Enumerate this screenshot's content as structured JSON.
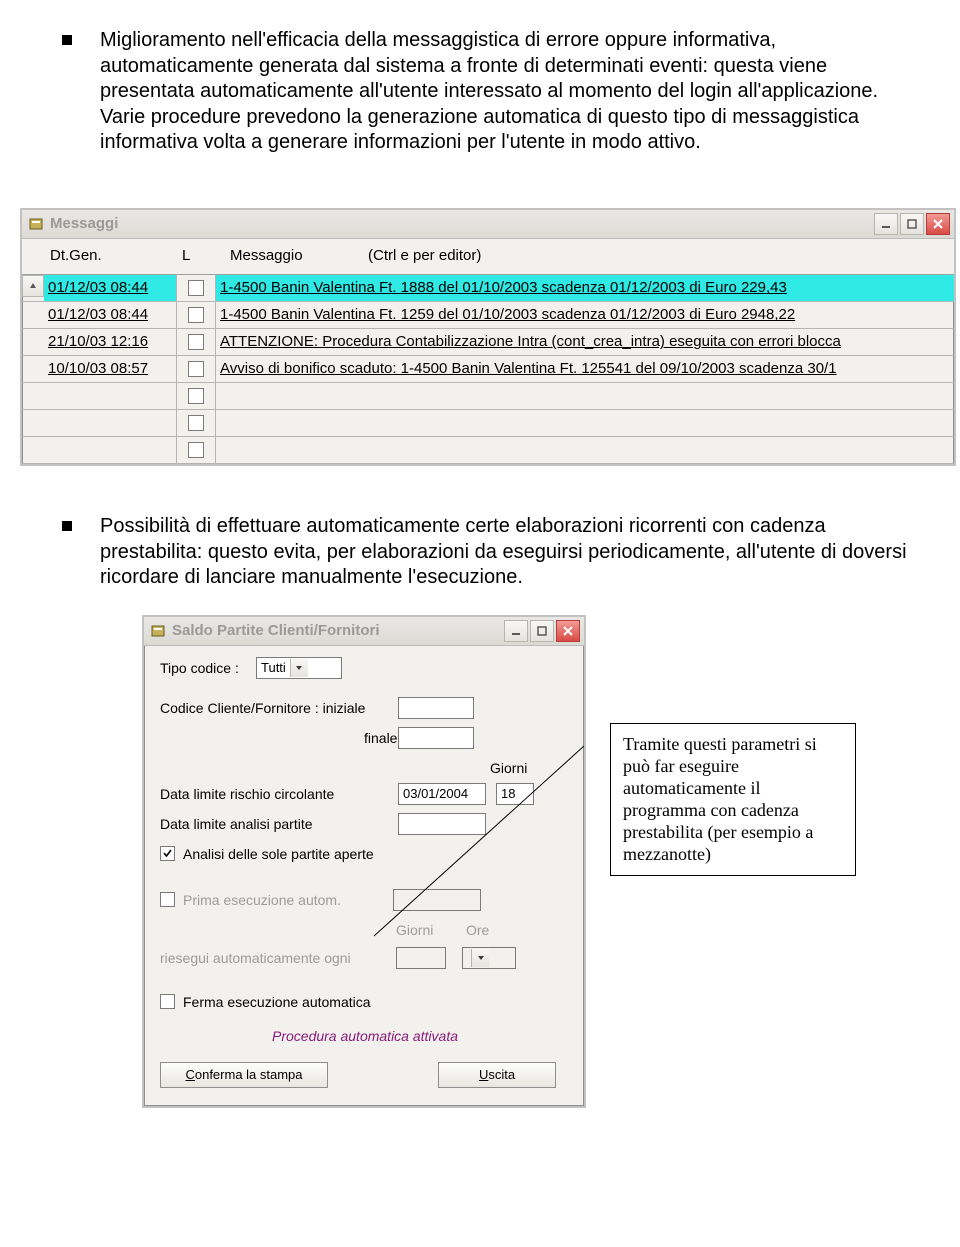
{
  "paragraphs": {
    "p1": "Miglioramento nell'efficacia della messaggistica di errore oppure informativa, automaticamente generata dal sistema a fronte di determinati eventi: questa viene presentata automaticamente all'utente interessato al momento del login all'applicazione. Varie procedure prevedono la generazione automatica di questo tipo di messaggistica informativa volta a generare informazioni per l'utente in modo attivo.",
    "p2": "Possibilità di effettuare automaticamente certe elaborazioni ricorrenti con cadenza prestabilita: questo evita, per elaborazioni da eseguirsi periodicamente, all'utente di doversi ricordare di lanciare manualmente l'esecuzione."
  },
  "messages_window": {
    "title": "Messaggi",
    "headers": {
      "dt": "Dt.Gen.",
      "l": "L",
      "msg": "Messaggio",
      "editor": "(Ctrl e per editor)"
    },
    "rows": [
      {
        "dt": "01/12/03 08:44",
        "msg": "1-4500 Banin Valentina Ft. 1888 del 01/10/2003 scadenza 01/12/2003 di Euro 229,43",
        "selected": true
      },
      {
        "dt": "01/12/03 08:44",
        "msg": "1-4500 Banin Valentina Ft. 1259 del 01/10/2003 scadenza 01/12/2003 di Euro 2948,22",
        "selected": false
      },
      {
        "dt": "21/10/03 12:16",
        "msg": "ATTENZIONE: Procedura Contabilizzazione Intra (cont_crea_intra) eseguita con errori blocca",
        "selected": false
      },
      {
        "dt": "10/10/03 08:57",
        "msg": "Avviso di bonifico scaduto: 1-4500 Banin Valentina Ft. 125541 del 09/10/2003 scadenza 30/1",
        "selected": false
      }
    ]
  },
  "saldo_window": {
    "title": "Saldo Partite Clienti/Fornitori",
    "labels": {
      "tipo_codice": "Tipo codice :",
      "codice_cf": "Codice Cliente/Fornitore : iniziale",
      "finale": "finale",
      "giorni": "Giorni",
      "data_rischio": "Data limite rischio circolante",
      "data_analisi": "Data limite analisi partite",
      "analisi_aperte": "Analisi delle sole partite aperte",
      "prima_esec": "Prima esecuzione autom.",
      "giorni2": "Giorni",
      "ore": "Ore",
      "riesegui": "riesegui automaticamente ogni",
      "ferma": "Ferma esecuzione automatica",
      "procedura": "Procedura automatica attivata"
    },
    "values": {
      "tipo_codice": "Tutti",
      "data_rischio": "03/01/2004",
      "giorni": "18"
    },
    "buttons": {
      "conferma": "Conferma la stampa",
      "uscita": "Uscita"
    }
  },
  "callout": "Tramite questi parametri si può far eseguire automaticamente il programma con cadenza prestabilita (per esempio a mezzanotte)"
}
